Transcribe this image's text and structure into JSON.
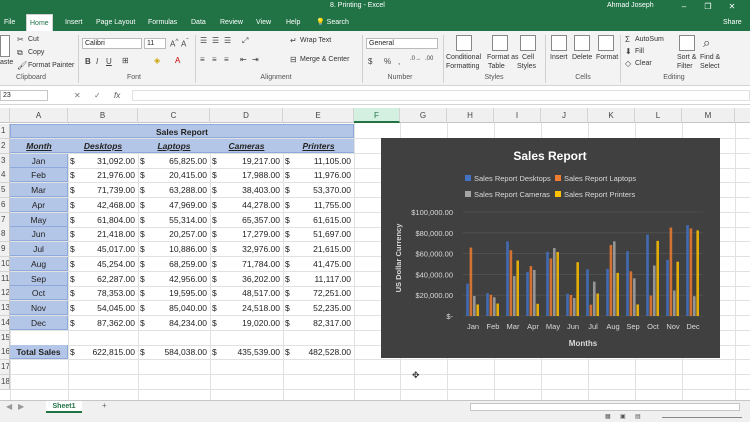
{
  "window": {
    "doc_title": "8. Printing  -  Excel",
    "user": "Ahmad Joseph"
  },
  "tabs": [
    "File",
    "Home",
    "Insert",
    "Page Layout",
    "Formulas",
    "Data",
    "Review",
    "View",
    "Help"
  ],
  "tell_me": "Search",
  "share": "Share",
  "ribbon": {
    "clipboard": {
      "paste": "aste",
      "cut": "Cut",
      "copy": "Copy",
      "painter": "Format Painter",
      "label": "Clipboard"
    },
    "font": {
      "name": "Calibri",
      "size": "11",
      "bold": "B",
      "italic": "I",
      "underline": "U",
      "label": "Font"
    },
    "alignment": {
      "wrap": "Wrap Text",
      "merge": "Merge & Center",
      "label": "Alignment"
    },
    "number": {
      "format": "General",
      "currency": "$",
      "percent": "%",
      "comma": ",",
      "label": "Number"
    },
    "styles": {
      "cond_line1": "Conditional",
      "cond_line2": "Formatting",
      "fmt_table_line1": "Format as",
      "fmt_table_line2": "Table",
      "cell_styles_line1": "Cell",
      "cell_styles_line2": "Styles",
      "label": "Styles"
    },
    "cells": {
      "insert": "Insert",
      "delete": "Delete",
      "format": "Format",
      "label": "Cells"
    },
    "editing": {
      "autosum": "AutoSum",
      "fill": "Fill",
      "clear": "Clear",
      "sort_line1": "Sort &",
      "sort_line2": "Filter",
      "find_line1": "Find &",
      "find_line2": "Select",
      "label": "Editing"
    }
  },
  "formula_bar": {
    "name_box": "23",
    "fx": "fx",
    "cancel": "✕",
    "enter": "✓"
  },
  "columns": [
    "A",
    "B",
    "C",
    "D",
    "E",
    "F",
    "G",
    "H",
    "I",
    "J",
    "K",
    "L",
    "M"
  ],
  "rows": [
    "1",
    "2",
    "3",
    "4",
    "5",
    "6",
    "7",
    "8",
    "9",
    "10",
    "11",
    "12",
    "13",
    "14",
    "15",
    "16",
    "17",
    "18"
  ],
  "sheet": {
    "title": "Sales Report",
    "headers": [
      "Month",
      "Desktops",
      "Laptops",
      "Cameras",
      "Printers"
    ],
    "data": [
      [
        "Jan",
        "31,092.00",
        "65,825.00",
        "19,217.00",
        "11,105.00"
      ],
      [
        "Feb",
        "21,976.00",
        "20,415.00",
        "17,988.00",
        "11,976.00"
      ],
      [
        "Mar",
        "71,739.00",
        "63,288.00",
        "38,403.00",
        "53,370.00"
      ],
      [
        "Apr",
        "42,468.00",
        "47,969.00",
        "44,278.00",
        "11,755.00"
      ],
      [
        "May",
        "61,804.00",
        "55,314.00",
        "65,357.00",
        "61,615.00"
      ],
      [
        "Jun",
        "21,418.00",
        "20,257.00",
        "17,279.00",
        "51,697.00"
      ],
      [
        "Jul",
        "45,017.00",
        "10,886.00",
        "32,976.00",
        "21,615.00"
      ],
      [
        "Aug",
        "45,254.00",
        "68,259.00",
        "71,784.00",
        "41,475.00"
      ],
      [
        "Sep",
        "62,287.00",
        "42,956.00",
        "36,202.00",
        "11,117.00"
      ],
      [
        "Oct",
        "78,353.00",
        "19,595.00",
        "48,517.00",
        "72,251.00"
      ],
      [
        "Nov",
        "54,045.00",
        "85,040.00",
        "24,518.00",
        "52,235.00"
      ],
      [
        "Dec",
        "87,362.00",
        "84,234.00",
        "19,020.00",
        "82,317.00"
      ]
    ],
    "currency": "$",
    "total_label": "Total Sales",
    "totals": [
      "622,815.00",
      "584,038.00",
      "435,539.00",
      "482,528.00"
    ]
  },
  "chart_data": {
    "type": "bar",
    "title": "Sales Report",
    "xlabel": "Months",
    "ylabel": "US Dollar Currency",
    "categories": [
      "Jan",
      "Feb",
      "Mar",
      "Apr",
      "May",
      "Jun",
      "Jul",
      "Aug",
      "Sep",
      "Oct",
      "Nov",
      "Dec"
    ],
    "ylim": [
      0,
      100000
    ],
    "yticks": [
      "$-",
      "$20,000.00",
      "$40,000.00",
      "$60,000.00",
      "$80,000.00",
      "$100,000.00"
    ],
    "legend_position": "top",
    "series": [
      {
        "name": "Sales Report Desktops",
        "color": "#4472c4",
        "values": [
          31092,
          21976,
          71739,
          42468,
          61804,
          21418,
          45017,
          45254,
          62287,
          78353,
          54045,
          87362
        ]
      },
      {
        "name": "Sales Report Laptops",
        "color": "#ed7d31",
        "values": [
          65825,
          20415,
          63288,
          47969,
          55314,
          20257,
          10886,
          68259,
          42956,
          19595,
          85040,
          84234
        ]
      },
      {
        "name": "Sales Report Cameras",
        "color": "#a5a5a5",
        "values": [
          19217,
          17988,
          38403,
          44278,
          65357,
          17279,
          32976,
          71784,
          36202,
          48517,
          24518,
          19020
        ]
      },
      {
        "name": "Sales Report Printers",
        "color": "#ffc000",
        "values": [
          11105,
          11976,
          53370,
          11755,
          61615,
          51697,
          21615,
          41475,
          11117,
          72251,
          52235,
          82317
        ]
      }
    ]
  },
  "sheet_tab": "Sheet1",
  "add_sheet": "+",
  "colors": {
    "accent": "#217346",
    "header_fill": "#b4c6e7",
    "chart_bg": "#404040"
  }
}
